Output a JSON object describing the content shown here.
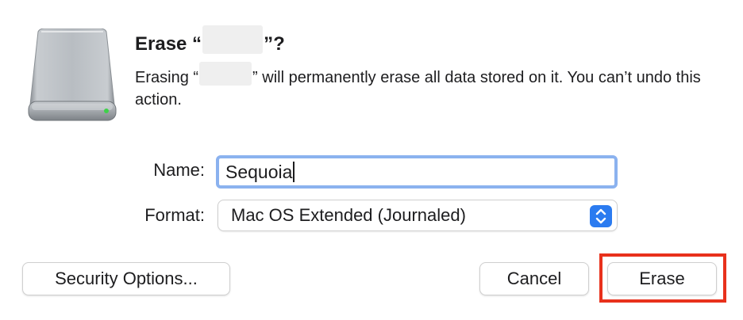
{
  "dialog": {
    "title_prefix": "Erase “",
    "title_suffix": "”?",
    "message_prefix": "Erasing “",
    "message_suffix": "” will permanently erase all data stored on it. You can’t undo this action."
  },
  "form": {
    "name_label": "Name:",
    "name_value": "Sequoia",
    "format_label": "Format:",
    "format_value": "Mac OS Extended (Journaled)"
  },
  "buttons": {
    "security_options": "Security Options...",
    "cancel": "Cancel",
    "erase": "Erase"
  },
  "icons": {
    "drive": "external-drive-icon",
    "select_arrows": "chevron-up-down-icon"
  },
  "colors": {
    "focus_ring": "#8bb2ef",
    "accent": "#2b7bf0",
    "highlight": "#e8311c"
  }
}
